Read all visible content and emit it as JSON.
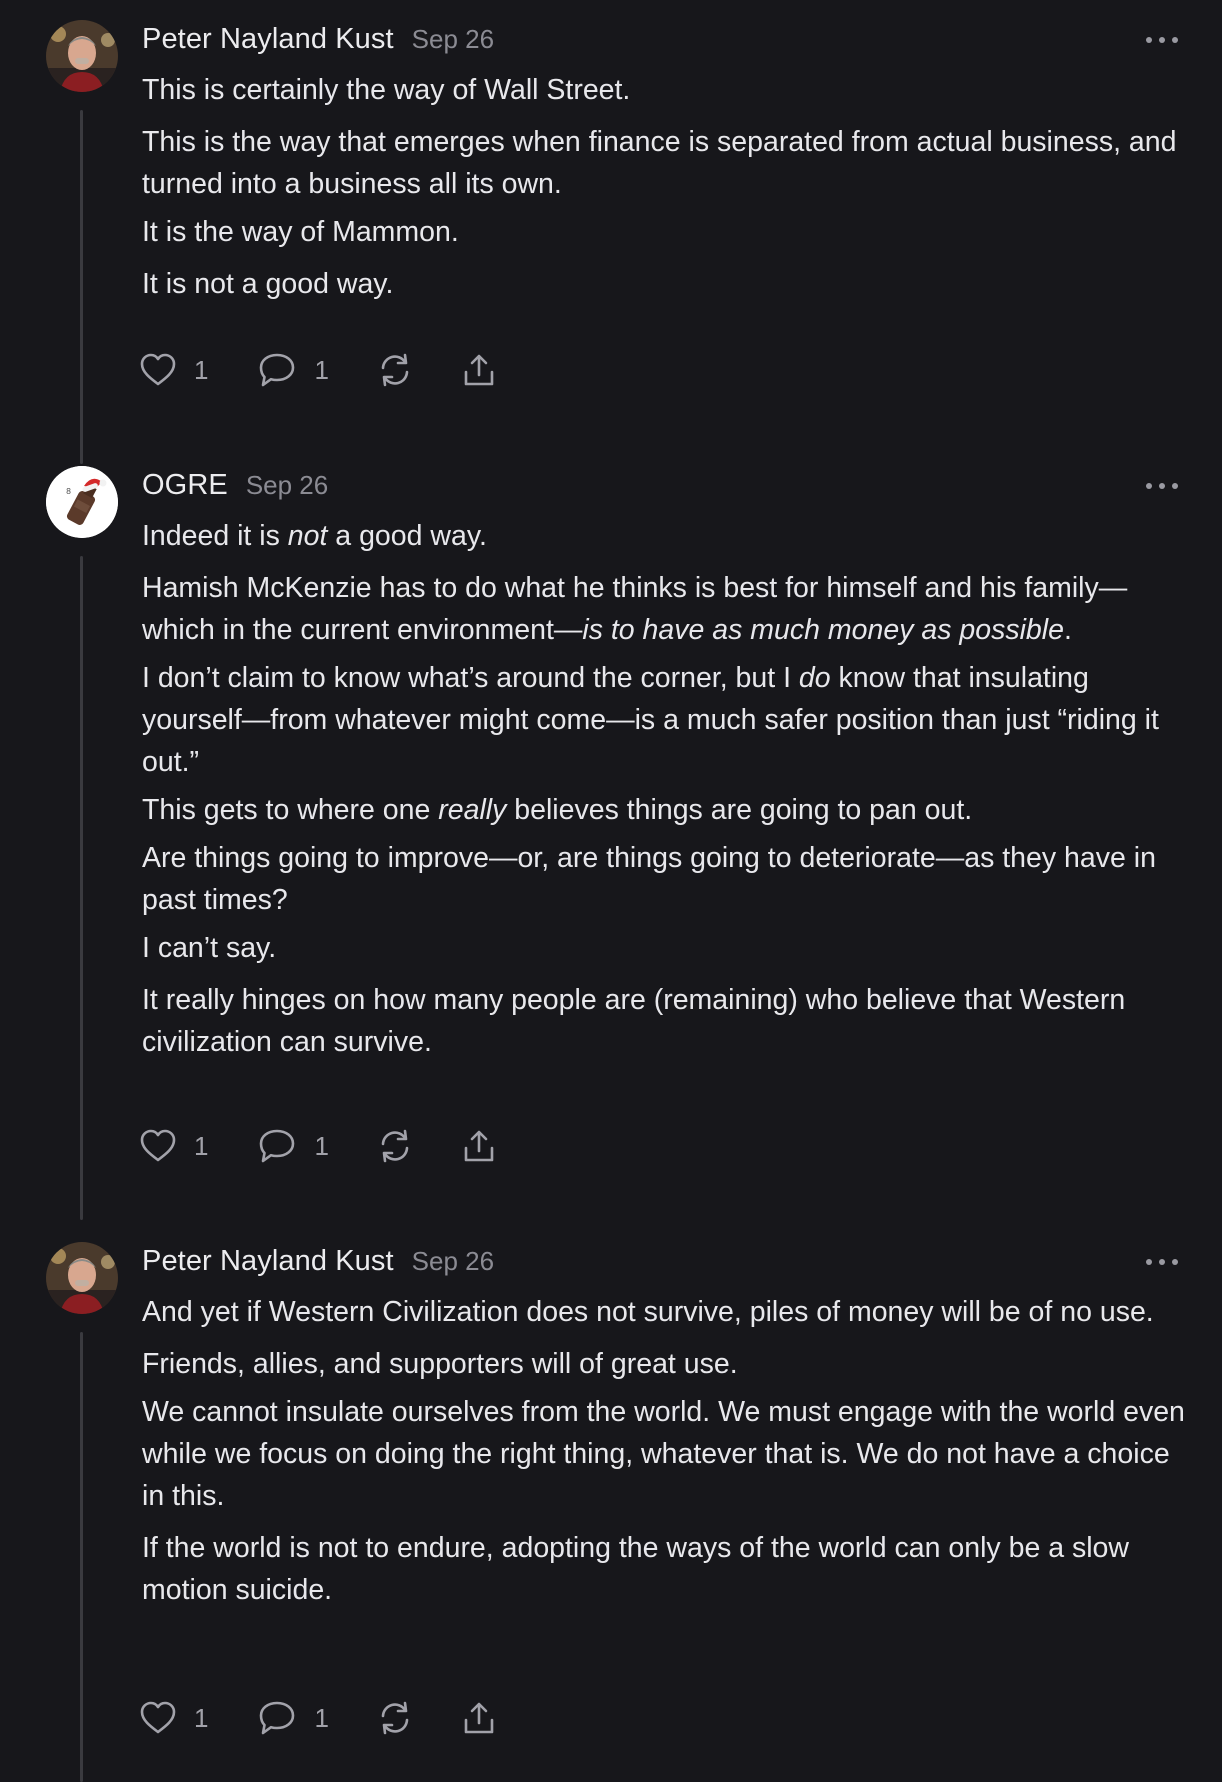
{
  "comments": [
    {
      "author": "Peter Nayland Kust",
      "date": "Sep 26",
      "avatar": "man-portrait-avatar",
      "paragraphs": [
        {
          "segments": [
            {
              "t": "This is certainly the way of Wall Street."
            }
          ]
        },
        {
          "segments": [
            {
              "t": "This is the way that emerges when finance is separated from actual business, and turned into a business all its own."
            }
          ]
        },
        {
          "segments": [
            {
              "t": "It is the way of Mammon."
            }
          ]
        },
        {
          "segments": [
            {
              "t": "It is not a good way."
            }
          ]
        }
      ],
      "likes": "1",
      "replies": "1"
    },
    {
      "author": "OGRE",
      "date": "Sep 26",
      "avatar": "bottle-santa-hat-avatar",
      "paragraphs": [
        {
          "segments": [
            {
              "t": "Indeed it is "
            },
            {
              "t": "not",
              "em": true
            },
            {
              "t": " a good way."
            }
          ]
        },
        {
          "segments": [
            {
              "t": "Hamish McKenzie has to do what he thinks is best for himself and his family—which in the current environment—"
            },
            {
              "t": "is to have as much money as possible",
              "em": true
            },
            {
              "t": "."
            }
          ]
        },
        {
          "segments": [
            {
              "t": "I don’t claim to know what’s around the corner, but I "
            },
            {
              "t": "do",
              "em": true
            },
            {
              "t": " know that insulating yourself—from whatever might come—is a much safer position than just “riding it out.”"
            }
          ]
        },
        {
          "segments": [
            {
              "t": "This gets to where one "
            },
            {
              "t": "really",
              "em": true
            },
            {
              "t": " believes things are going to pan out."
            }
          ]
        },
        {
          "segments": [
            {
              "t": "Are things going to improve—or, are things going to deteriorate—as they have in past times?"
            }
          ]
        },
        {
          "segments": [
            {
              "t": "I can’t say."
            }
          ]
        },
        {
          "segments": [
            {
              "t": "It really hinges on how many people are (remaining) who believe that Western civilization can survive."
            }
          ]
        }
      ],
      "likes": "1",
      "replies": "1"
    },
    {
      "author": "Peter Nayland Kust",
      "date": "Sep 26",
      "avatar": "man-portrait-avatar",
      "paragraphs": [
        {
          "segments": [
            {
              "t": "And yet if Western Civilization does not survive, piles of money will be of no use."
            }
          ]
        },
        {
          "segments": [
            {
              "t": "Friends, allies, and supporters will of great use."
            }
          ]
        },
        {
          "segments": [
            {
              "t": "We cannot insulate ourselves from the world. We must engage with the world even while we focus on doing the right thing, whatever that is. We do not have a choice in this."
            }
          ]
        },
        {
          "segments": [
            {
              "t": "If the world is not to endure, adopting the ways of the world can only be a slow motion suicide."
            }
          ]
        }
      ],
      "likes": "1",
      "replies": "1"
    }
  ],
  "icons": {
    "like": "heart-icon",
    "reply": "comment-icon",
    "restack": "restack-icon",
    "share": "share-icon",
    "more": "more-options-icon"
  },
  "colors": {
    "background": "#17171b",
    "text": "#e8e8ec",
    "muted": "#8b8b93",
    "thread_line": "#3a3a3f"
  }
}
